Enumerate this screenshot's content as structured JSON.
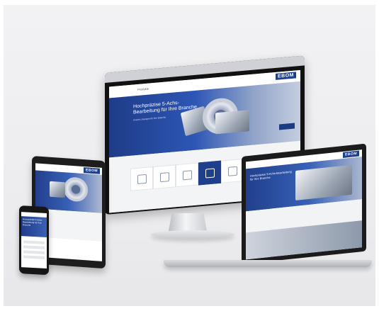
{
  "brand": {
    "logo": "EBOM",
    "accent": "#1e3f8e",
    "hero_gradient_light": "#c5cedf"
  },
  "monitor_site": {
    "nav": [
      "",
      "Produkte",
      "",
      "",
      ""
    ],
    "hero_title": "Hochpräzise 5-Achs-Bearbeitung für Ihre Branche",
    "hero_subtitle": "Unsere Lösungen für Ihre Branche",
    "tiles": [
      {
        "icon": "aircraft-icon",
        "active": false
      },
      {
        "icon": "car-icon",
        "active": false
      },
      {
        "icon": "helmet-icon",
        "active": false
      },
      {
        "icon": "machine-icon",
        "active": true
      },
      {
        "icon": "medical-icon",
        "active": false
      },
      {
        "icon": "tool-icon",
        "active": false
      }
    ]
  },
  "tablet_site": {
    "logo": "EBOM"
  },
  "phone_site": {
    "hero_title": "Hochpräzise 5-Achs-Bearbeitung für Ihre Branche"
  },
  "laptop_site": {
    "logo": "EBOM",
    "hero_title": "Hochpräzise 5-Achs-Bearbeitung für Ihre Branche"
  }
}
